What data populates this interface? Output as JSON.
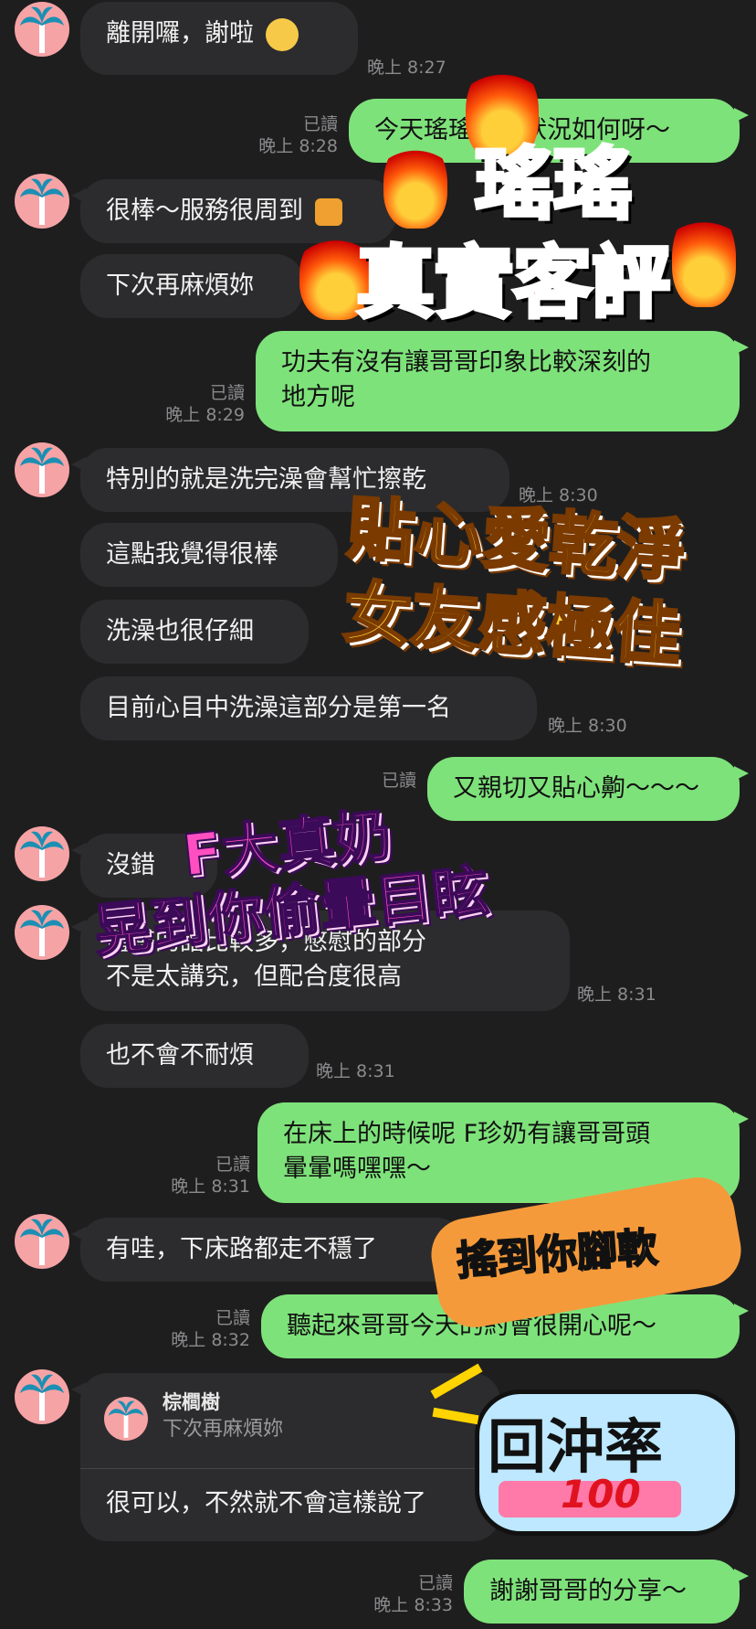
{
  "messages": {
    "m1": {
      "text": "離開囉，謝啦",
      "time": "晚上 8:27"
    },
    "m2": {
      "text": "今天瑤瑤妹妹狀況如何呀～",
      "read": "已讀",
      "time": "晚上 8:28"
    },
    "m3": {
      "text": "很棒～服務很周到"
    },
    "m4": {
      "text": "下次再麻煩妳"
    },
    "m5": {
      "line1": "功夫有沒有讓哥哥印象比較深刻的",
      "line2": "地方呢",
      "read": "已讀",
      "time": "晚上 8:29"
    },
    "m6": {
      "text": "特別的就是洗完澡會幫忙擦乾",
      "time": "晚上 8:30"
    },
    "m7": {
      "text": "這點我覺得很棒"
    },
    "m8": {
      "text": "洗澡也很仔細"
    },
    "m9": {
      "text": "目前心目中洗澡這部分是第一名",
      "time": "晚上 8:30"
    },
    "m10": {
      "text": "又親切又貼心齁～～～",
      "read": "已讀"
    },
    "m11": {
      "text": "沒錯"
    },
    "m12": {
      "line1": "體感的話比較多，憋慰的部分",
      "line2": "不是太講究，但配合度很高",
      "time": "晚上 8:31"
    },
    "m13": {
      "text": "也不會不耐煩",
      "time": "晚上 8:31"
    },
    "m14": {
      "line1": "在床上的時候呢 F珍奶有讓哥哥頭",
      "line2": "暈暈嗎嘿嘿～",
      "read": "已讀",
      "time": "晚上 8:31"
    },
    "m15": {
      "text": "有哇，下床路都走不穩了"
    },
    "m16": {
      "text": "聽起來哥哥今天的約會很開心呢～",
      "read": "已讀",
      "time": "晚上 8:32"
    },
    "m17": {
      "reply_name": "棕櫚樹",
      "reply_text": "下次再麻煩妳",
      "text": "很可以，不然就不會這樣說了"
    },
    "m18": {
      "text": "謝謝哥哥的分享～",
      "read": "已讀",
      "time": "晚上 8:33"
    }
  },
  "stickers": {
    "title1": "瑤瑤",
    "title2": "真實客評",
    "gold1": "貼心愛乾淨",
    "gold2": "女友感極佳",
    "pink1": "F大真奶",
    "pink2": "晃到你偷暈目眩",
    "orange": "搖到你腳軟",
    "stamp": "回沖率",
    "stamp_num": "100"
  },
  "colors": {
    "outgoing": "#7ee27a",
    "incoming": "#2c2c2e",
    "background": "#1e1e1f",
    "avatar": "#f6a3a5"
  }
}
